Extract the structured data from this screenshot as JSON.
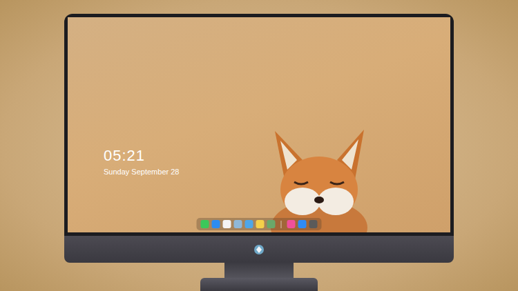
{
  "desktop": {
    "clock": {
      "time": "05:21",
      "date": "Sunday September 28"
    }
  },
  "dock": {
    "apps": [
      {
        "icon": "messages",
        "color": "#3cc85a"
      },
      {
        "icon": "finder",
        "color": "#2d8cf0"
      },
      {
        "icon": "safari",
        "color": "#f4f4f4"
      },
      {
        "icon": "preview",
        "color": "#8fb8d8"
      },
      {
        "icon": "files",
        "color": "#4ea6e8"
      },
      {
        "icon": "notes",
        "color": "#f5d04a"
      },
      {
        "icon": "photos",
        "color": "#6aa86a"
      }
    ],
    "pinned": [
      {
        "icon": "music",
        "color": "#f0509a"
      },
      {
        "icon": "app-store",
        "color": "#2f8bf5"
      },
      {
        "icon": "camera",
        "color": "#5a5a5a"
      }
    ]
  }
}
